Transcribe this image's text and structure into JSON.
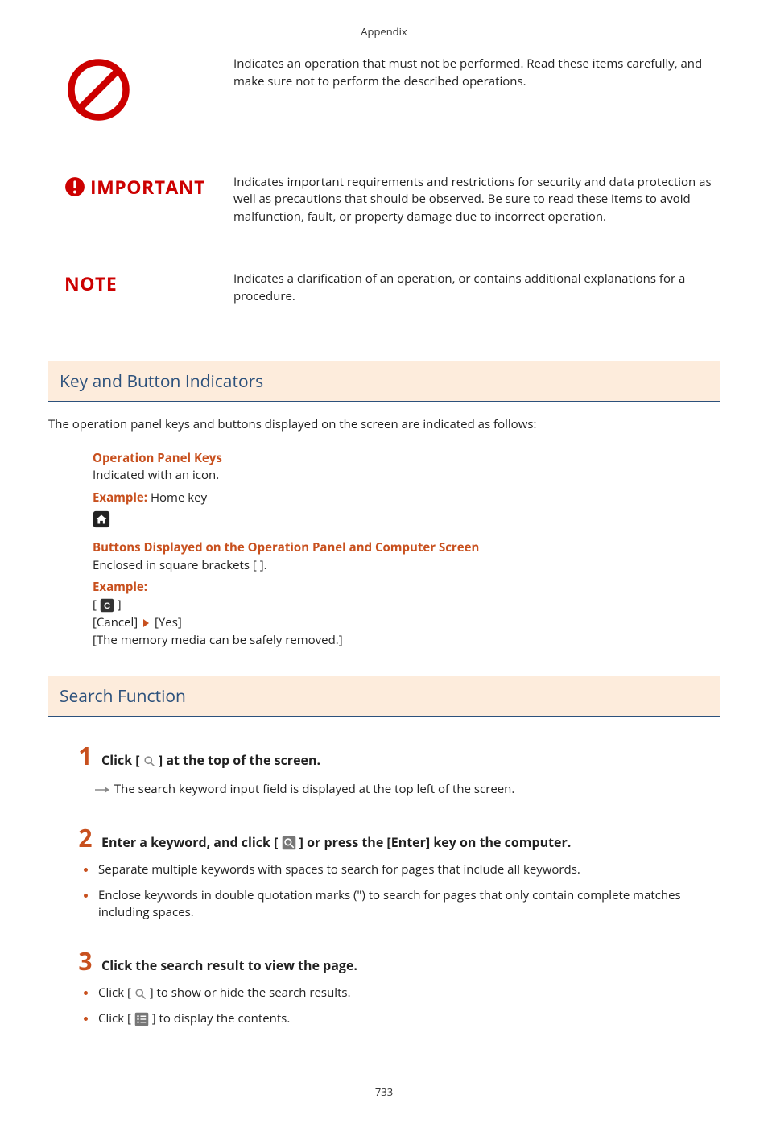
{
  "header": "Appendix",
  "page_number": "733",
  "marks": {
    "prohibit": {
      "desc": "Indicates an operation that must not be performed. Read these items carefully, and make sure not to perform the described operations."
    },
    "important": {
      "label": "IMPORTANT",
      "desc": "Indicates important requirements and restrictions for security and data protection as well as precautions that should be observed. Be sure to read these items to avoid malfunction, fault, or property damage due to incorrect operation."
    },
    "note": {
      "label": "NOTE",
      "desc": "Indicates a clarification of an operation, or contains additional explanations for a procedure."
    }
  },
  "sections": {
    "keys": {
      "title": "Key and Button Indicators",
      "intro": "The operation panel keys and buttons displayed on the screen are indicated as follows:",
      "op_keys_head": "Operation Panel Keys",
      "op_keys_text": "Indicated with an icon.",
      "op_keys_example_label": "Example:",
      "op_keys_example_text": " Home key",
      "buttons_head": "Buttons Displayed on the Operation Panel and Computer Screen",
      "buttons_text": "Enclosed in square brackets [ ].",
      "buttons_example_label": "Example:",
      "buttons_ex_line2_a": "[Cancel] ",
      "buttons_ex_line2_b": " [Yes]",
      "buttons_ex_line3": "[The memory media can be safely removed.]"
    },
    "search": {
      "title": "Search Function",
      "steps": [
        {
          "num": "1",
          "text_a": "Click [ ",
          "text_b": " ] at the top of the screen.",
          "result": "The search keyword input field is displayed at the top left of the screen."
        },
        {
          "num": "2",
          "text_a": "Enter a keyword, and click [",
          "text_b": "] or press the [Enter] key on the computer.",
          "bullets": [
            "Separate multiple keywords with spaces to search for pages that include all keywords.",
            "Enclose keywords in double quotation marks (\") to search for pages that only contain complete matches including spaces."
          ]
        },
        {
          "num": "3",
          "text": "Click the search result to view the page.",
          "sub_a_pre": "Click [ ",
          "sub_a_post": " ] to show or hide the search results.",
          "sub_b_pre": "Click [ ",
          "sub_b_post": " ] to display the contents."
        }
      ]
    }
  },
  "icons": {
    "prohibit": "prohibit-icon",
    "important": "important-icon",
    "home": "home-icon",
    "c_key": "c-icon",
    "search_plain": "search-icon",
    "search_box": "search-icon-boxed",
    "list_box": "list-icon-boxed",
    "result_arrow": "result-arrow-icon"
  }
}
